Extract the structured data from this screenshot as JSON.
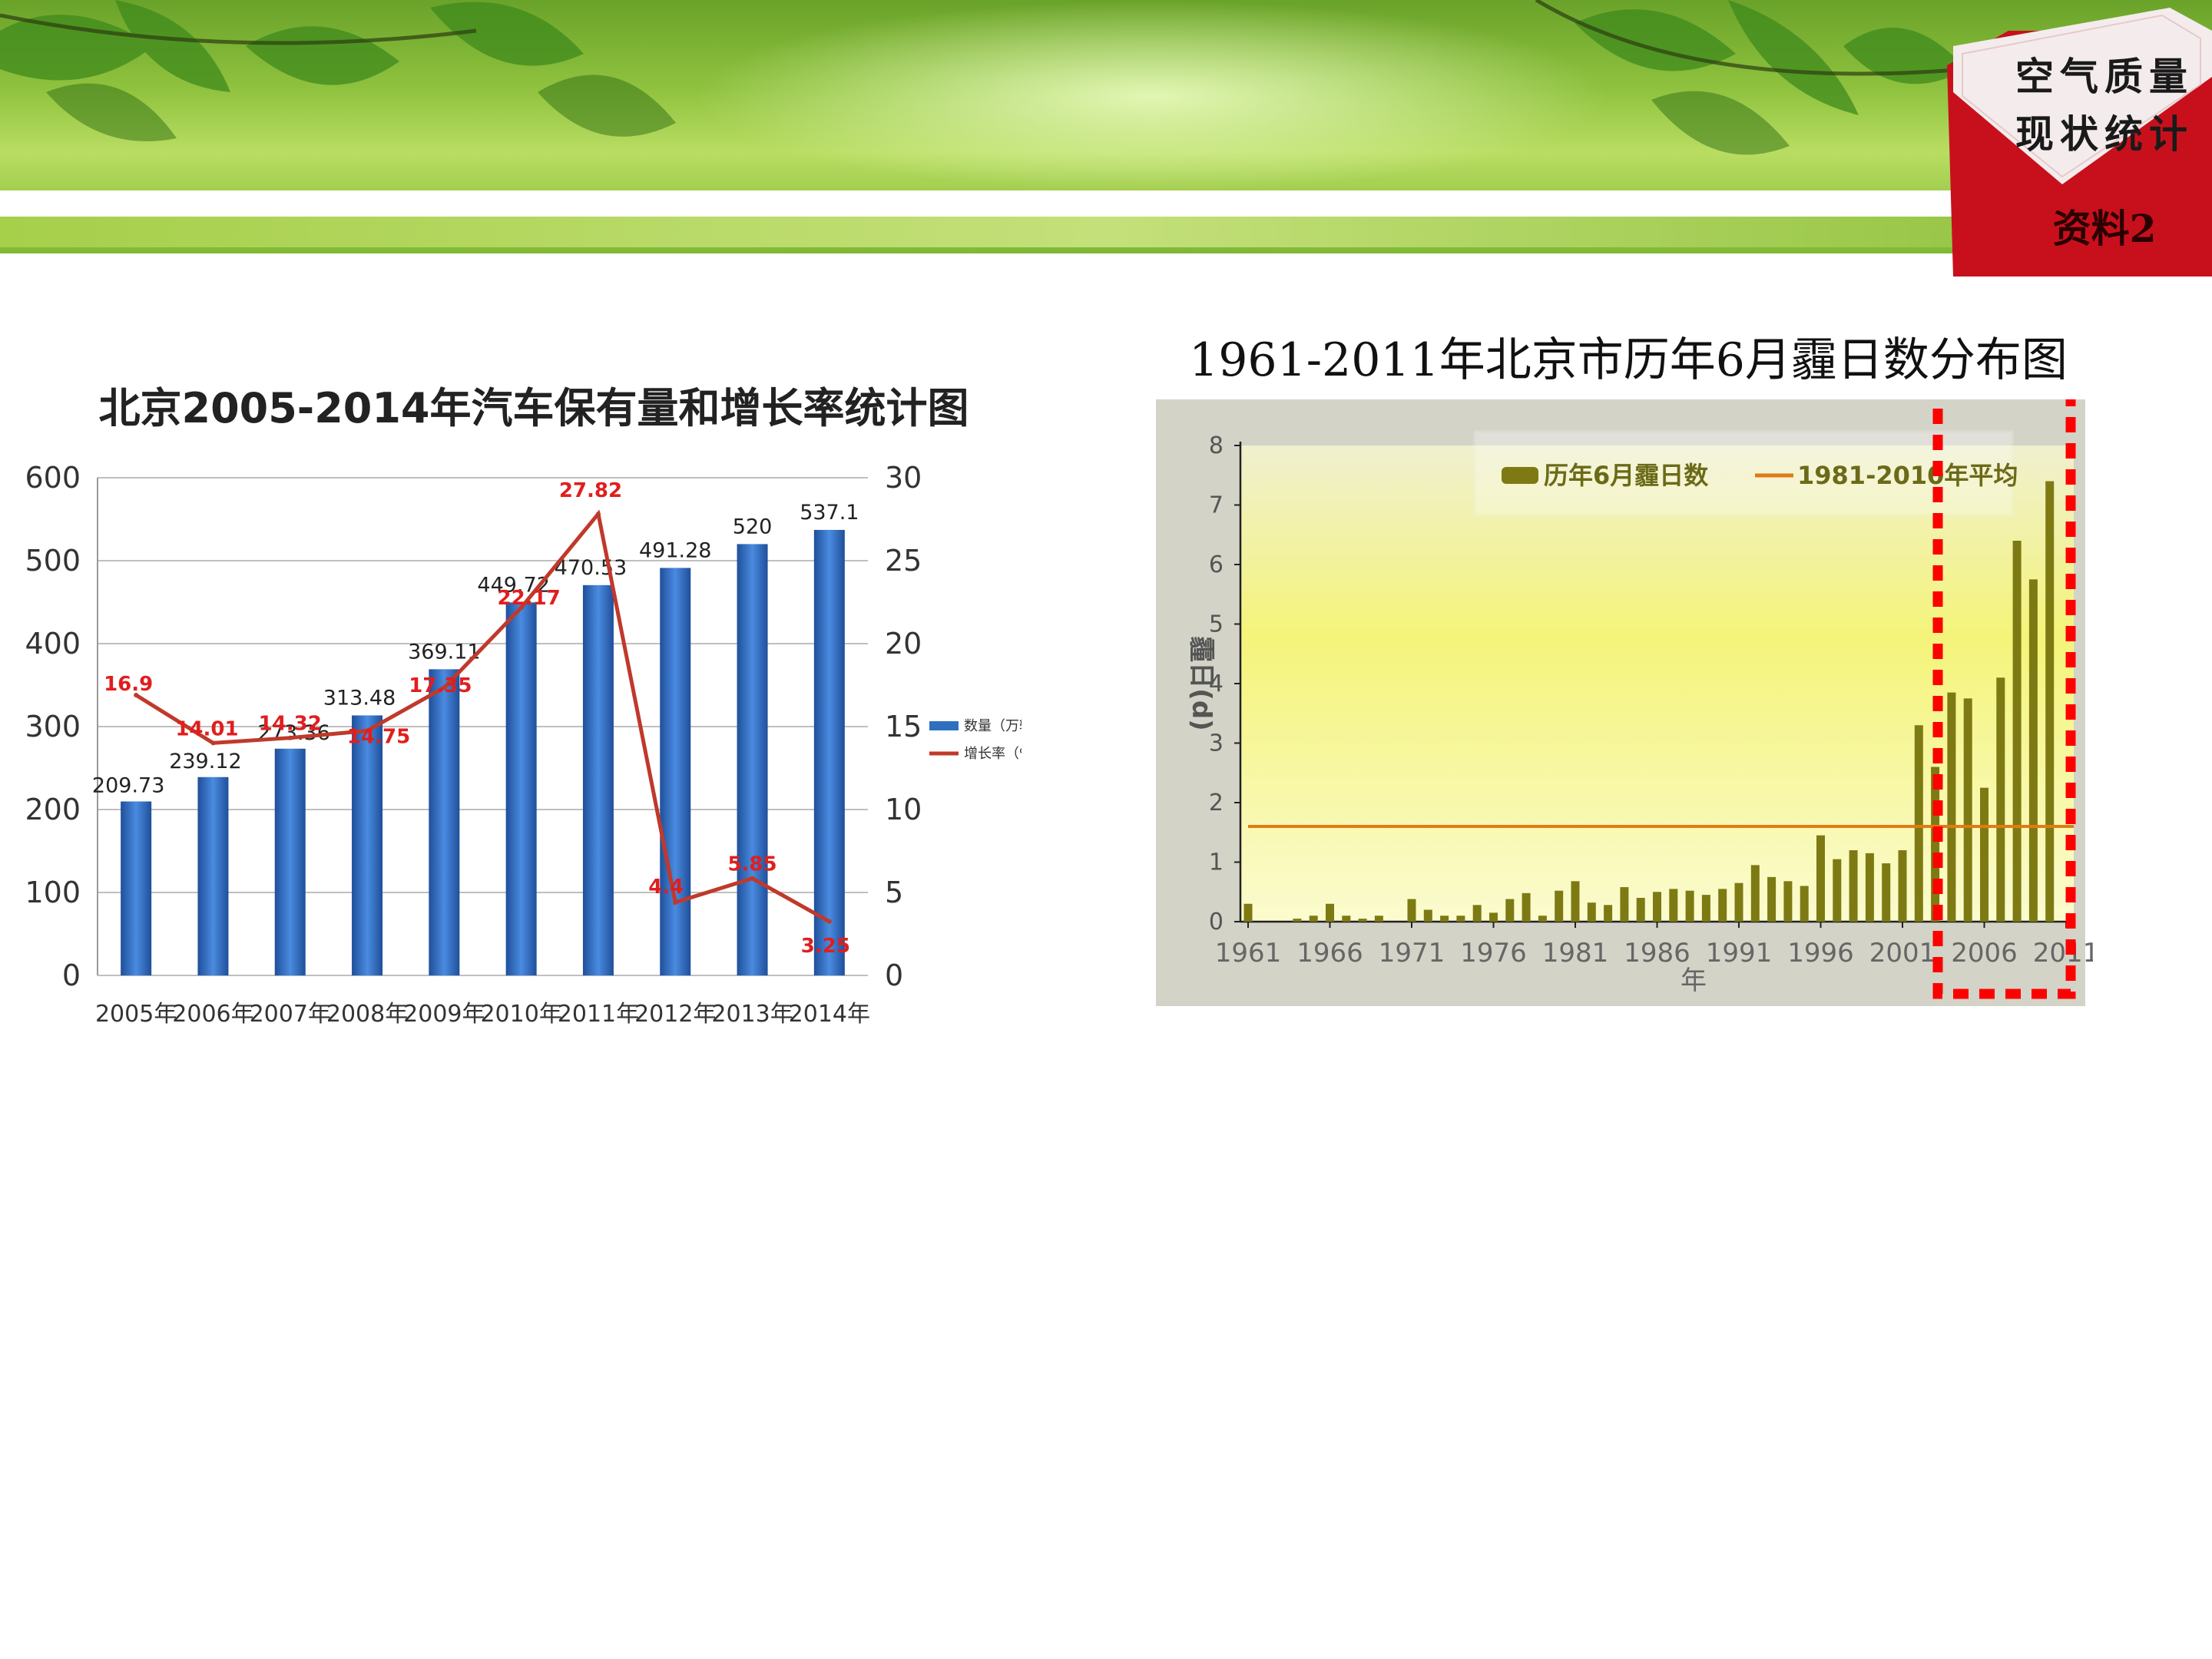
{
  "badge": {
    "line1": "空气质量",
    "line2": "现状统计",
    "line3": "资料2"
  },
  "colors": {
    "bar_blue": "#2f6fbf",
    "line_red": "#c0392b",
    "bar_olive": "#7d7a14",
    "avg_orange": "#e07b14",
    "dotted_red": "#ff0000"
  },
  "chart_data": [
    {
      "type": "bar",
      "title": "北京2005-2014年汽车保有量和增长率统计图",
      "categories": [
        "2005年",
        "2006年",
        "2007年",
        "2008年",
        "2009年",
        "2010年",
        "2011年",
        "2012年",
        "2013年",
        "2014年"
      ],
      "series": [
        {
          "name": "数量（万辆）",
          "type": "bar",
          "axis": "left",
          "values": [
            209.73,
            239.12,
            273.36,
            313.48,
            369.11,
            449.72,
            470.53,
            491.28,
            520,
            537.1
          ],
          "labels": [
            "209.73",
            "239.12",
            "273.36",
            "313.48",
            "369.11",
            "449.72",
            "470.53",
            "491.28",
            "520",
            "537.1"
          ]
        },
        {
          "name": "增长率（%）",
          "type": "line",
          "axis": "right",
          "values": [
            16.9,
            14.01,
            14.32,
            14.75,
            17.35,
            22.17,
            27.82,
            4.4,
            5.85,
            3.25
          ],
          "labels": [
            "16.9",
            "14.01",
            "14.32",
            "14.75",
            "17.35",
            "22.17",
            "27.82",
            "4.4",
            "5.85",
            "3.25"
          ]
        }
      ],
      "ylim_left": [
        0,
        600
      ],
      "yticks_left": [
        "0",
        "100",
        "200",
        "300",
        "400",
        "500",
        "600"
      ],
      "ylim_right": [
        0,
        30
      ],
      "yticks_right": [
        "0",
        "5",
        "10",
        "15",
        "20",
        "25",
        "30"
      ],
      "grid": true,
      "legend_position": "right"
    },
    {
      "type": "bar",
      "title": "1961-2011年北京市历年6月霾日数分布图",
      "xlabel": "年",
      "ylabel": "霾日(d)",
      "x": [
        1961,
        1962,
        1963,
        1964,
        1965,
        1966,
        1967,
        1968,
        1969,
        1970,
        1971,
        1972,
        1973,
        1974,
        1975,
        1976,
        1977,
        1978,
        1979,
        1980,
        1981,
        1982,
        1983,
        1984,
        1985,
        1986,
        1987,
        1988,
        1989,
        1990,
        1991,
        1992,
        1993,
        1994,
        1995,
        1996,
        1997,
        1998,
        1999,
        2000,
        2001,
        2002,
        2003,
        2004,
        2005,
        2006,
        2007,
        2008,
        2009,
        2010,
        2011
      ],
      "xticks": [
        "1961",
        "1966",
        "1971",
        "1976",
        "1981",
        "1986",
        "1991",
        "1996",
        "2001",
        "2006",
        "2011"
      ],
      "yticks": [
        "0",
        "1",
        "2",
        "3",
        "4",
        "5",
        "6",
        "7",
        "8"
      ],
      "ylim": [
        0,
        8
      ],
      "series": [
        {
          "name": "历年6月霾日数",
          "type": "bar",
          "values": [
            0.3,
            0,
            0,
            0.05,
            0.1,
            0.3,
            0.1,
            0.05,
            0.1,
            0,
            0.38,
            0.2,
            0.1,
            0.1,
            0.28,
            0.15,
            0.38,
            0.48,
            0.1,
            0.52,
            0.68,
            0.32,
            0.28,
            0.58,
            0.4,
            0.5,
            0.55,
            0.52,
            0.45,
            0.55,
            0.65,
            0.95,
            0.75,
            0.68,
            0.6,
            1.45,
            1.05,
            1.2,
            1.15,
            0.98,
            1.2,
            3.3,
            2.6,
            3.85,
            3.75,
            2.25,
            4.1,
            6.4,
            5.75,
            7.4,
            0
          ]
        },
        {
          "name": "1981-2010年平均",
          "type": "line",
          "values": [
            1.6
          ]
        }
      ],
      "grid": false,
      "legend_position": "top"
    }
  ]
}
